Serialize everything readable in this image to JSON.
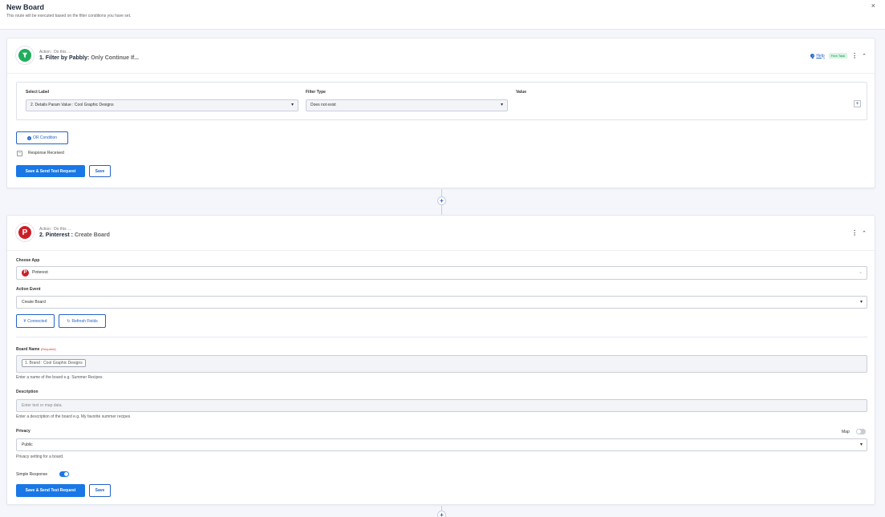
{
  "header": {
    "title": "New Board",
    "subtitle": "This route will be executed based on the filter conditions you have set.",
    "close_label": "×"
  },
  "step1": {
    "action_label": "Action : Do this ...",
    "title": "1. Filter by Pabbly:",
    "title_sub": "Only Continue If...",
    "help_label": "Help",
    "badge": "Free Task",
    "filter": {
      "select_label_header": "Select Label",
      "filter_type_header": "Filter Type",
      "value_header": "Value",
      "selected_label": "2. Details Param Value : Cool Graphic Designs",
      "selected_filter_type": "Does not exist"
    },
    "or_condition_label": "OR Condition",
    "response_received_label": "Response Received",
    "save_send_label": "Save & Send Test Request",
    "save_label": "Save"
  },
  "step2": {
    "action_label": "Action : Do this ...",
    "title": "2. Pinterest :",
    "title_sub": "Create Board",
    "choose_app_label": "Choose App",
    "app_value": "Pinterest",
    "action_event_label": "Action Event",
    "action_event_value": "Create Board",
    "connected_label": "Connected",
    "refresh_label": "Refresh Fields",
    "board_name_label": "Board Name",
    "required_label": "(Required)",
    "board_name_chip": "1. Brand : Cool Graphic Designs",
    "board_name_hint": "Enter a name of the board e.g. Summer Recipes",
    "description_label": "Description",
    "description_placeholder": "Enter text or map data.",
    "description_hint": "Enter a description of the board e.g. My favorite summer recipes",
    "privacy_label": "Privacy",
    "map_label": "Map",
    "privacy_value": "Public",
    "privacy_hint": "Privacy setting for a board.",
    "simple_response_label": "Simple Response",
    "simple_response_on": true,
    "save_send_label": "Save & Send Test Request",
    "save_label": "Save"
  },
  "connector_plus": "+",
  "colors": {
    "primary": "#1977e6",
    "filter_green": "#1fae5b",
    "pinterest_red": "#cb1f27",
    "free_task_bg": "#d4f5e1"
  },
  "icons": {
    "filter": "filter-icon",
    "pinterest": "pinterest-icon",
    "kebab": "kebab-menu-icon",
    "chevron": "chevron-up-icon",
    "plus": "plus-icon"
  }
}
